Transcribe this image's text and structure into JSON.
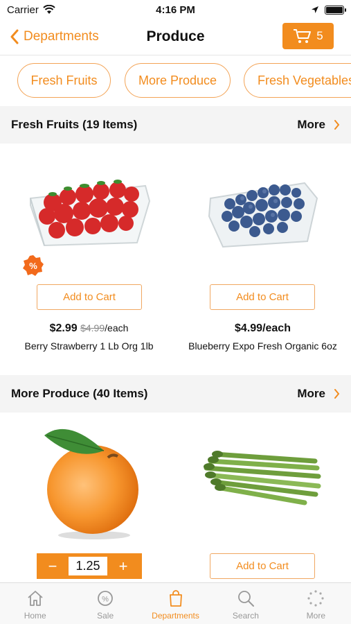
{
  "status_bar": {
    "carrier": "Carrier",
    "time": "4:16 PM"
  },
  "nav": {
    "back_label": "Departments",
    "title": "Produce",
    "cart_count": "5"
  },
  "chips": [
    {
      "label": "Fresh Fruits"
    },
    {
      "label": "More Produce"
    },
    {
      "label": "Fresh Vegetables"
    }
  ],
  "sections": [
    {
      "title": "Fresh Fruits (19 Items)",
      "more": "More"
    },
    {
      "title": "More Produce (40 Items)",
      "more": "More"
    }
  ],
  "products": [
    {
      "name": "Berry Strawberry 1 Lb Org 1lb",
      "price": "$2.99",
      "was_price": "$4.99",
      "unit": "/each",
      "button": "Add to Cart"
    },
    {
      "name": "Blueberry Expo Fresh Organic 6oz",
      "price": "$4.99",
      "unit": "/each",
      "button": "Add to Cart"
    },
    {
      "quantity": "1.25",
      "minus": "−",
      "plus": "+"
    },
    {
      "button": "Add to Cart"
    }
  ],
  "tabs": [
    {
      "label": "Home"
    },
    {
      "label": "Sale"
    },
    {
      "label": "Departments"
    },
    {
      "label": "Search"
    },
    {
      "label": "More"
    }
  ],
  "colors": {
    "accent": "#f28c1e"
  }
}
